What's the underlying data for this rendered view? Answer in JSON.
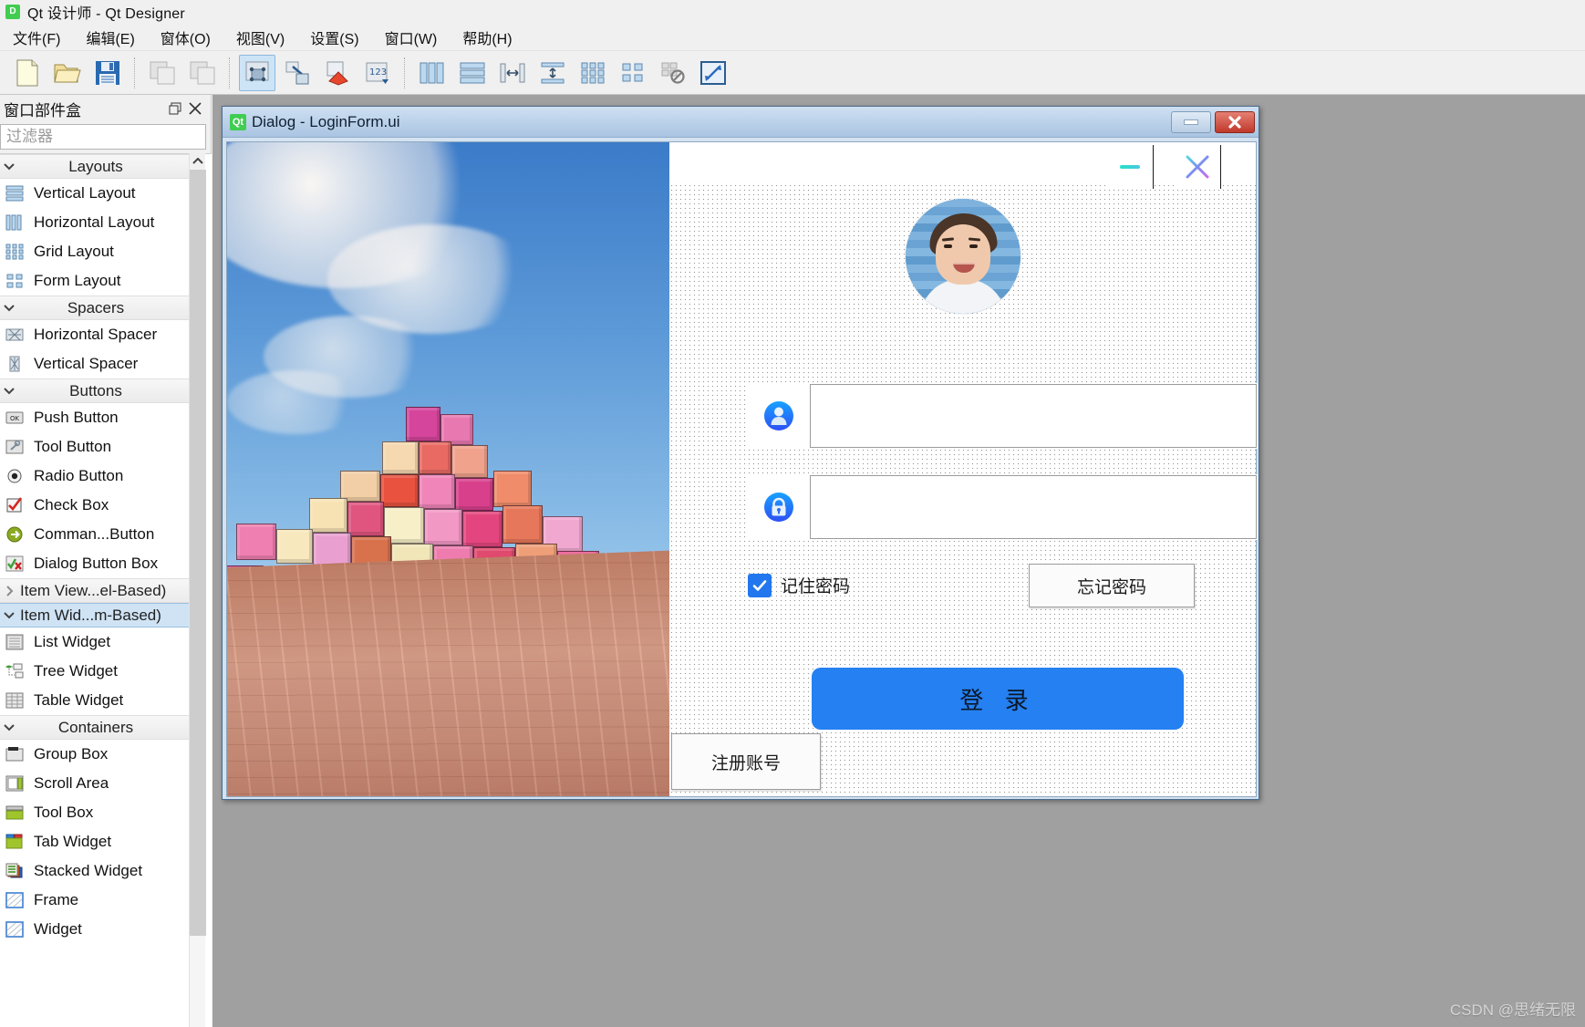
{
  "window": {
    "app_icon": "qt-designer-icon",
    "title": "Qt 设计师 - Qt Designer"
  },
  "menubar": {
    "items": [
      {
        "label": "文件(F)",
        "name": "menu-file"
      },
      {
        "label": "编辑(E)",
        "name": "menu-edit"
      },
      {
        "label": "窗体(O)",
        "name": "menu-form"
      },
      {
        "label": "视图(V)",
        "name": "menu-view"
      },
      {
        "label": "设置(S)",
        "name": "menu-settings"
      },
      {
        "label": "窗口(W)",
        "name": "menu-window"
      },
      {
        "label": "帮助(H)",
        "name": "menu-help"
      }
    ]
  },
  "toolbar": {
    "groups": [
      [
        "new-file-icon",
        "open-file-icon",
        "save-file-icon"
      ],
      [
        "undo-icon",
        "redo-icon"
      ],
      [
        "edit-widgets-icon",
        "edit-signals-slots-icon",
        "edit-buddies-icon",
        "edit-tab-order-icon"
      ],
      [
        "layout-horizontally-icon",
        "layout-vertically-icon",
        "layout-splitter-horizontal-icon",
        "layout-splitter-vertical-icon",
        "layout-grid-icon",
        "layout-form-icon",
        "break-layout-icon",
        "adjust-size-icon"
      ]
    ],
    "active_tool": "edit-widgets-icon"
  },
  "widget_box": {
    "title": "窗口部件盒",
    "float_button": "undock-icon",
    "close_button": "close-icon",
    "filter_placeholder": "过滤器",
    "filter_value": "",
    "sections": [
      {
        "name": "Layouts",
        "expanded": true,
        "selected": false,
        "items": [
          {
            "label": "Vertical Layout",
            "icon": "vertical-layout-icon"
          },
          {
            "label": "Horizontal Layout",
            "icon": "horizontal-layout-icon"
          },
          {
            "label": "Grid Layout",
            "icon": "grid-layout-icon"
          },
          {
            "label": "Form Layout",
            "icon": "form-layout-icon"
          }
        ]
      },
      {
        "name": "Spacers",
        "expanded": true,
        "selected": false,
        "items": [
          {
            "label": "Horizontal Spacer",
            "icon": "horizontal-spacer-icon"
          },
          {
            "label": "Vertical Spacer",
            "icon": "vertical-spacer-icon"
          }
        ]
      },
      {
        "name": "Buttons",
        "expanded": true,
        "selected": false,
        "items": [
          {
            "label": "Push Button",
            "icon": "push-button-icon"
          },
          {
            "label": "Tool Button",
            "icon": "tool-button-icon"
          },
          {
            "label": "Radio Button",
            "icon": "radio-button-icon"
          },
          {
            "label": "Check Box",
            "icon": "check-box-icon"
          },
          {
            "label": "Comman...Button",
            "icon": "command-link-button-icon"
          },
          {
            "label": "Dialog Button Box",
            "icon": "dialog-button-box-icon"
          }
        ]
      },
      {
        "name": "Item View...el-Based)",
        "expanded": false,
        "selected": false,
        "items": []
      },
      {
        "name": "Item Wid...m-Based)",
        "expanded": true,
        "selected": true,
        "items": [
          {
            "label": "List Widget",
            "icon": "list-widget-icon"
          },
          {
            "label": "Tree Widget",
            "icon": "tree-widget-icon"
          },
          {
            "label": "Table Widget",
            "icon": "table-widget-icon"
          }
        ]
      },
      {
        "name": "Containers",
        "expanded": true,
        "selected": false,
        "items": [
          {
            "label": "Group Box",
            "icon": "group-box-icon"
          },
          {
            "label": "Scroll Area",
            "icon": "scroll-area-icon"
          },
          {
            "label": "Tool Box",
            "icon": "tool-box-icon"
          },
          {
            "label": "Tab Widget",
            "icon": "tab-widget-icon"
          },
          {
            "label": "Stacked Widget",
            "icon": "stacked-widget-icon"
          },
          {
            "label": "Frame",
            "icon": "frame-icon"
          },
          {
            "label": "Widget",
            "icon": "widget-icon"
          }
        ]
      }
    ]
  },
  "form_window": {
    "icon": "qt-icon",
    "title": "Dialog - LoginForm.ui",
    "minimize_label": "–",
    "close_label": "✕"
  },
  "login_form": {
    "artwork_alt": "colorful-cubes-photo",
    "window_minimize": "minimize-icon",
    "window_close": "close-icon",
    "avatar": "user-avatar-photo",
    "username": {
      "icon": "user-icon",
      "value": "",
      "placeholder": ""
    },
    "password": {
      "icon": "lock-icon",
      "value": "",
      "placeholder": ""
    },
    "remember": {
      "checked": true,
      "label": "记住密码"
    },
    "forgot_label": "忘记密码",
    "login_label": "登 录",
    "register_label": "注册账号",
    "accent_color": "#2580f2",
    "checkbox_color": "#2277ee"
  },
  "watermark": "CSDN @思绪无限"
}
